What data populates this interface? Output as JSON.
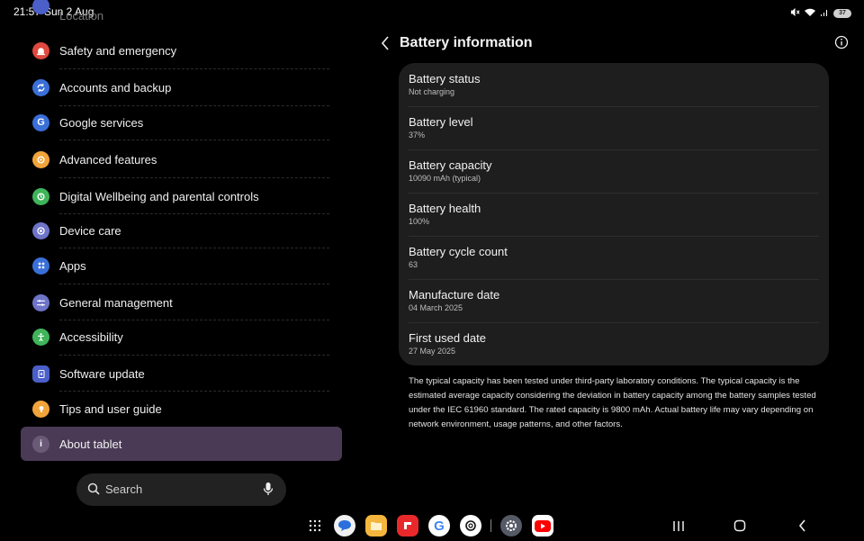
{
  "status_bar": {
    "time": "21:57",
    "date": "Sun 2 Aug",
    "battery": "37"
  },
  "settings_list": {
    "partial_item": "Location",
    "items": [
      {
        "label": "Safety and emergency",
        "icon": "alert-icon",
        "color": "#e0493f"
      },
      {
        "label": "Accounts and backup",
        "icon": "sync-icon",
        "color": "#3a6fd8"
      },
      {
        "label": "Google services",
        "icon": "google-icon",
        "color": "#3a6fd8"
      },
      {
        "label": "Advanced features",
        "icon": "star-gear-icon",
        "color": "#f2a43a"
      },
      {
        "label": "Digital Wellbeing and parental controls",
        "icon": "wellbeing-icon",
        "color": "#3fb45a"
      },
      {
        "label": "Device care",
        "icon": "device-care-icon",
        "color": "#6e74c8"
      },
      {
        "label": "Apps",
        "icon": "apps-icon",
        "color": "#3a6fd8"
      },
      {
        "label": "General management",
        "icon": "sliders-icon",
        "color": "#6e74c8"
      },
      {
        "label": "Accessibility",
        "icon": "accessibility-icon",
        "color": "#3fb45a"
      },
      {
        "label": "Software update",
        "icon": "update-icon",
        "color": "#4a5fc8"
      },
      {
        "label": "Tips and user guide",
        "icon": "lightbulb-icon",
        "color": "#f2a43a"
      },
      {
        "label": "About tablet",
        "icon": "info-icon",
        "color": "#6a5a78"
      }
    ]
  },
  "search": {
    "placeholder": "Search"
  },
  "battery_info": {
    "title": "Battery information",
    "rows": [
      {
        "title": "Battery status",
        "value": "Not charging"
      },
      {
        "title": "Battery level",
        "value": "37%"
      },
      {
        "title": "Battery capacity",
        "value": "10090 mAh (typical)"
      },
      {
        "title": "Battery health",
        "value": "100%"
      },
      {
        "title": "Battery cycle count",
        "value": "63"
      },
      {
        "title": "Manufacture date",
        "value": "04 March 2025"
      },
      {
        "title": "First used date",
        "value": "27 May 2025"
      }
    ],
    "note": "The typical capacity has been tested under third-party laboratory conditions. The typical capacity is the estimated average capacity considering the deviation in battery capacity among the battery samples tested under the IEC 61960 standard. The rated capacity is 9800 mAh. Actual battery life may vary depending on network environment, usage patterns, and other factors."
  },
  "taskbar": {
    "apps": [
      "app-drawer-icon",
      "messages-icon",
      "files-icon",
      "flipboard-icon",
      "google-icon",
      "chatgpt-icon",
      "settings-icon",
      "youtube-icon"
    ],
    "nav": [
      "recents-icon",
      "home-icon",
      "back-icon"
    ]
  }
}
